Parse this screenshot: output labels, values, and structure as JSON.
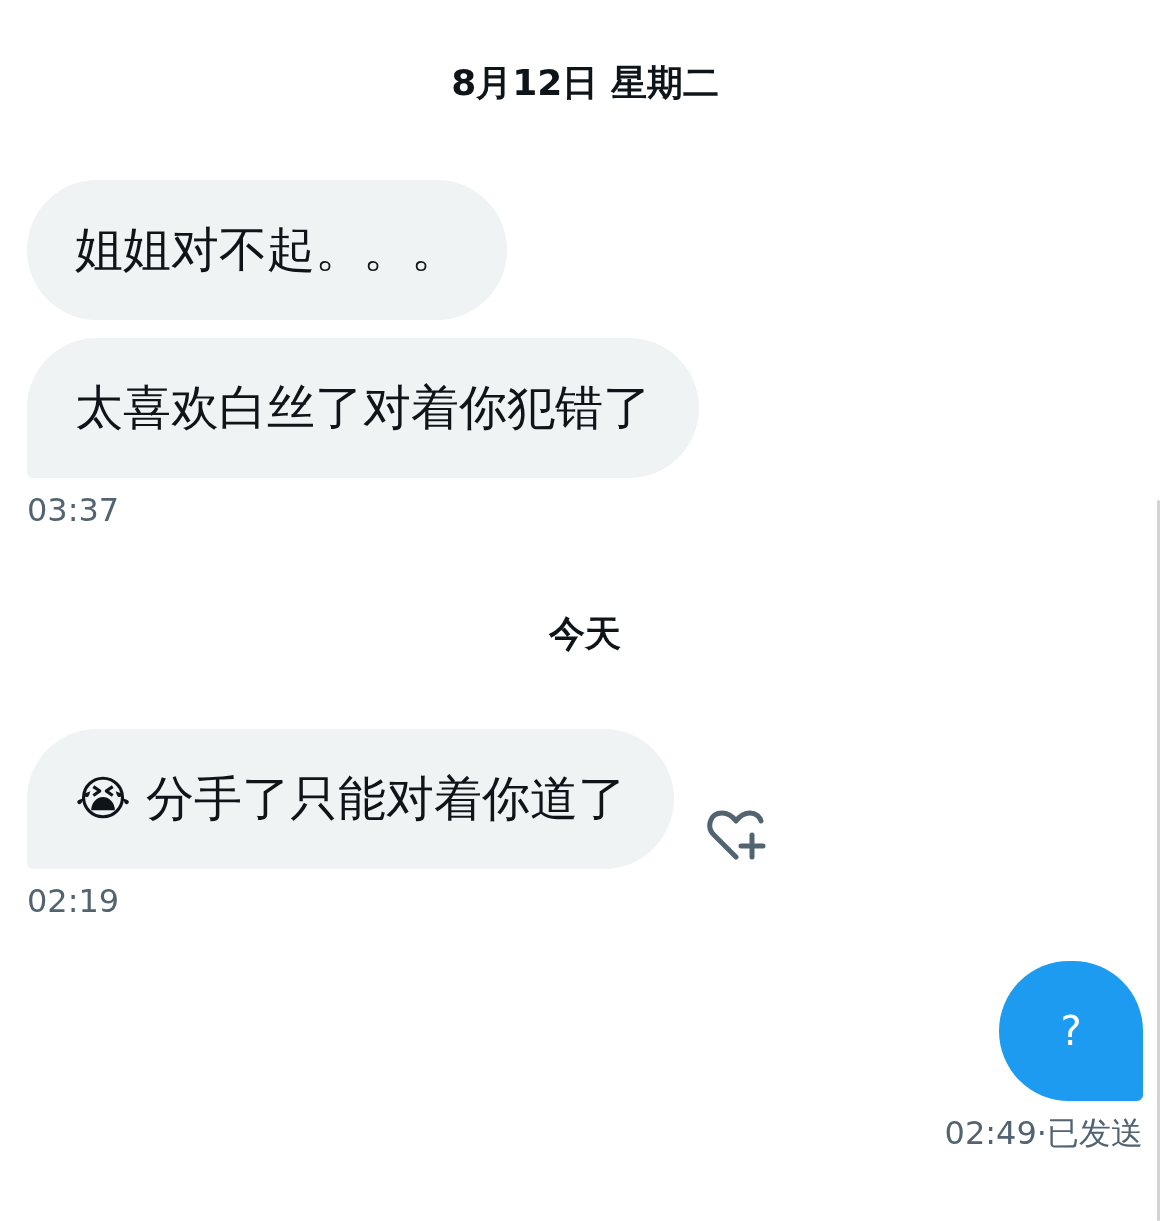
{
  "items": [
    {
      "kind": "date",
      "text": "8月12日 星期二"
    },
    {
      "kind": "incoming",
      "messages": [
        {
          "text": "姐姐对不起。。。"
        },
        {
          "text": "太喜欢白丝了对着你犯错了"
        }
      ],
      "time": "03:37",
      "react_button": false
    },
    {
      "kind": "date",
      "text": "今天"
    },
    {
      "kind": "incoming",
      "messages": [
        {
          "text": "😭 分手了只能对着你道了"
        }
      ],
      "time": "02:19",
      "react_button": true
    },
    {
      "kind": "outgoing",
      "messages": [
        {
          "text": "?"
        }
      ],
      "time": "02:49",
      "status": "·已发送"
    }
  ]
}
